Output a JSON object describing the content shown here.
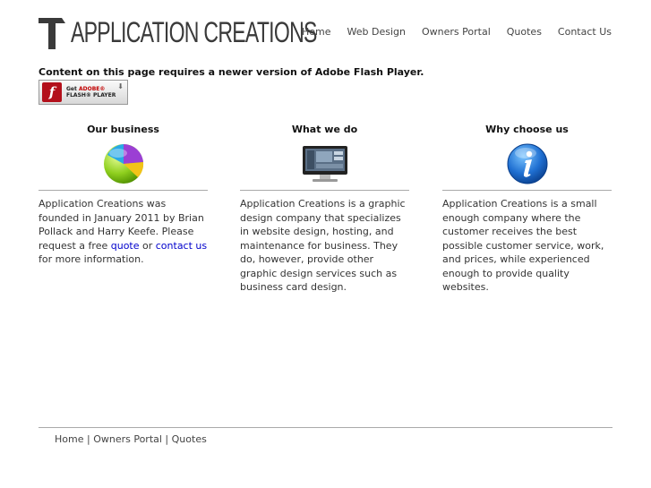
{
  "header": {
    "logo_text": "APPLICATION CREATIONS",
    "nav": [
      {
        "label": "Home"
      },
      {
        "label": "Web Design"
      },
      {
        "label": "Owners Portal"
      },
      {
        "label": "Quotes"
      },
      {
        "label": "Contact Us"
      }
    ]
  },
  "flash": {
    "message": "Content on this page requires a newer version of Adobe Flash Player.",
    "button_get": "Get",
    "button_adobe": "ADOBE®",
    "button_flash": "FLASH® PLAYER",
    "button_letter": "f"
  },
  "columns": [
    {
      "title": "Our business",
      "icon": "pie-chart-icon",
      "text_before": "Application Creations was founded in January 2011 by Brian Pollack and Harry Keefe. Please request a free ",
      "link1": "quote",
      "text_mid": " or ",
      "link2": "contact us",
      "text_after": " for more information."
    },
    {
      "title": "What we do",
      "icon": "monitor-icon",
      "text": "Application Creations is a graphic design company that specializes in website design, hosting, and maintenance for business. They do, however, provide other graphic design services such as business card design."
    },
    {
      "title": "Why choose us",
      "icon": "info-icon",
      "text": "Application Creations is a small enough company where the customer receives the best possible customer service, work, and prices, while experienced enough to provide quality websites."
    }
  ],
  "footer": {
    "links": [
      "Home",
      "Owners Portal",
      "Quotes"
    ],
    "separator": " | "
  },
  "colors": {
    "link": "#0000cc",
    "flash_red": "#b3101b",
    "rule": "#aaaaaa"
  }
}
